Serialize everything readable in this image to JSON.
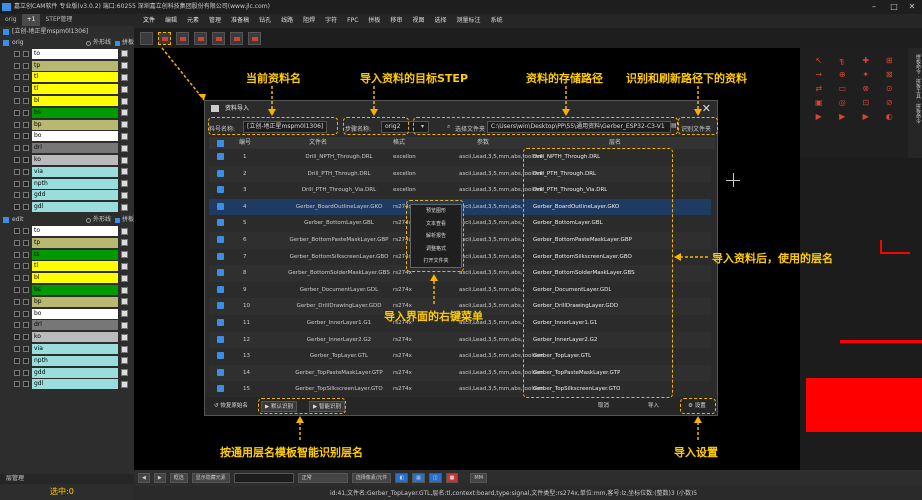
{
  "titlebar": {
    "text": "嘉立创CAM软件 专业版(v3.0.2) 端口:60255    深圳嘉立创科技集团股份有限公司(www.jlc.com)"
  },
  "left": {
    "tabs": [
      "orig",
      "+1",
      "STEP管理"
    ],
    "step_name": "[立创-地正星mspm0l1306]",
    "groups": [
      {
        "name": "orig",
        "outline": "外形线",
        "panel": "拼板",
        "layers": [
          {
            "name": "to",
            "color": "#ffffff"
          },
          {
            "name": "tp",
            "color": "#b8b870"
          },
          {
            "name": "tl",
            "color": "#ffff00"
          },
          {
            "name": "tl",
            "color": "#ffff00"
          },
          {
            "name": "bl",
            "color": "#ffff00"
          },
          {
            "name": "bs",
            "color": "#009900"
          },
          {
            "name": "bp",
            "color": "#b8b870"
          },
          {
            "name": "bo",
            "color": "#ffffff"
          },
          {
            "name": "drl",
            "color": "#777777"
          },
          {
            "name": "ko",
            "color": "#bbbbbb"
          },
          {
            "name": "via",
            "color": "#99dddd"
          },
          {
            "name": "npth",
            "color": "#99dddd"
          },
          {
            "name": "gdd",
            "color": "#99dddd"
          },
          {
            "name": "gdl",
            "color": "#99dddd"
          }
        ]
      },
      {
        "name": "edit",
        "outline": "外形线",
        "panel": "拼板",
        "layers": [
          {
            "name": "to",
            "color": "#ffffff"
          },
          {
            "name": "tp",
            "color": "#b8b870"
          },
          {
            "name": "ts",
            "color": "#009900"
          },
          {
            "name": "tl",
            "color": "#ffff00"
          },
          {
            "name": "bl",
            "color": "#ffff00"
          },
          {
            "name": "bs",
            "color": "#009900"
          },
          {
            "name": "bp",
            "color": "#b8b870"
          },
          {
            "name": "bo",
            "color": "#ffffff"
          },
          {
            "name": "drl",
            "color": "#777777"
          },
          {
            "name": "ko",
            "color": "#bbbbbb"
          },
          {
            "name": "via",
            "color": "#99dddd"
          },
          {
            "name": "npth",
            "color": "#99dddd"
          },
          {
            "name": "gdd",
            "color": "#99dddd"
          },
          {
            "name": "gdl",
            "color": "#99dddd"
          }
        ]
      }
    ],
    "bottom_tab": "层管理",
    "select_count": "选中:0"
  },
  "menubar": [
    "文件",
    "编辑",
    "元素",
    "管理",
    "准备稿",
    "钻孔",
    "线路",
    "阻焊",
    "字符",
    "FPC",
    "拼板",
    "移审",
    "视图",
    "选择",
    "测量标注",
    "系统"
  ],
  "annotations": {
    "current_name": "当前资料名",
    "target_step": "导入资料的目标STEP",
    "store_path": "资料的存储路径",
    "identify_refresh": "识别和刷新路径下的资料",
    "layer_name_after_import": "导入资料后，使用的层名",
    "right_click_menu": "导入界面的右键菜单",
    "auto_identify": "按通用层名模板智能识别层名",
    "import_settings": "导入设置"
  },
  "dialog": {
    "title": "资料导入",
    "name_label": "料号名称:",
    "name_value": "[立创-地正星mspm0l1306]",
    "step_label": "步骤名称:",
    "step_value": "orig2",
    "select_folder": "选择文件夹",
    "path_value": "C:\\Users\\win\\Desktop\\PP\\55\\通用资料\\Gerber_ESP32-C3-V1",
    "identify_folder": "识别文件夹",
    "columns": [
      "编号",
      "文件名",
      "格式",
      "参数",
      "层名"
    ],
    "rows": [
      {
        "no": "1",
        "file": "Drill_NPTH_Through.DRL",
        "fmt": "excellon",
        "param": "ascii,Lead,3,5,mm,abs,toolmm",
        "layer": "Drill_NPTH_Through.DRL"
      },
      {
        "no": "2",
        "file": "Drill_PTH_Through.DRL",
        "fmt": "excellon",
        "param": "ascii,Lead,3,5,mm,abs,toolmm",
        "layer": "Drill_PTH_Through.DRL"
      },
      {
        "no": "3",
        "file": "Drill_PTH_Through_Via.DRL",
        "fmt": "excellon",
        "param": "ascii,Lead,3,5,mm,abs,toolmm",
        "layer": "Drill_PTH_Through_Via.DRL"
      },
      {
        "no": "4",
        "file": "Gerber_BoardOutlineLayer.GKO",
        "fmt": "rs274x",
        "param": "ascii,Lead,3,5,mm,abs,",
        "layer": "Gerber_BoardOutlineLayer.GKO"
      },
      {
        "no": "5",
        "file": "Gerber_BottomLayer.GBL",
        "fmt": "rs274x",
        "param": "ascii,Lead,3,5,mm,abs,",
        "layer": "Gerber_BottomLayer.GBL"
      },
      {
        "no": "6",
        "file": "Gerber_BottomPasteMaskLayer.GBP",
        "fmt": "rs274x",
        "param": "ascii,Lead,3,5,mm,abs,",
        "layer": "Gerber_BottomPasteMaskLayer.GBP"
      },
      {
        "no": "7",
        "file": "Gerber_BottomSilkscreenLayer.GBO",
        "fmt": "rs274x",
        "param": "ascii,Lead,3,5,mm,abs,",
        "layer": "Gerber_BottomSilkscreenLayer.GBO"
      },
      {
        "no": "8",
        "file": "Gerber_BottomSolderMaskLayer.GBS",
        "fmt": "rs274x",
        "param": "ascii,Lead,3,5,mm,abs,",
        "layer": "Gerber_BottomSolderMaskLayer.GBS"
      },
      {
        "no": "9",
        "file": "Gerber_DocumentLayer.GDL",
        "fmt": "rs274x",
        "param": "ascii,Lead,3,5,mm,abs,",
        "layer": "Gerber_DocumentLayer.GDL"
      },
      {
        "no": "10",
        "file": "Gerber_DrillDrawingLayer.GDD",
        "fmt": "rs274x",
        "param": "ascii,Lead,3,5,mm,abs,",
        "layer": "Gerber_DrillDrawingLayer.GDD"
      },
      {
        "no": "11",
        "file": "Gerber_InnerLayer1.G1",
        "fmt": "rs274x",
        "param": "ascii,Lead,3,5,mm,abs,",
        "layer": "Gerber_InnerLayer1.G1"
      },
      {
        "no": "12",
        "file": "Gerber_InnerLayer2.G2",
        "fmt": "rs274x",
        "param": "ascii,Lead,3,5,mm,abs,",
        "layer": "Gerber_InnerLayer2.G2"
      },
      {
        "no": "13",
        "file": "Gerber_TopLayer.GTL",
        "fmt": "rs274x",
        "param": "ascii,Lead,3,5,mm,abs,toolmm",
        "layer": "Gerber_TopLayer.GTL"
      },
      {
        "no": "14",
        "file": "Gerber_TopPasteMaskLayer.GTP",
        "fmt": "rs274x",
        "param": "ascii,Lead,3,5,mm,abs,toolmm",
        "layer": "Gerber_TopPasteMaskLayer.GTP"
      },
      {
        "no": "15",
        "file": "Gerber_TopSilkscreenLayer.GTO",
        "fmt": "rs274x",
        "param": "ascii,Lead,3,5,mm,abs,toolmm",
        "layer": "Gerber_TopSilkscreenLayer.GTO"
      }
    ],
    "context_menu": [
      "预览图形",
      "文本查看",
      "解析报告",
      "调整格式",
      "打开文件夹"
    ],
    "restore_original": "恢复原始名",
    "default_identify": "默认识别",
    "auto_identify": "智能识别",
    "cancel": "取消",
    "import": "导入",
    "settings": "设置"
  },
  "statusbar": {
    "text": "id:41,文件名:Gerber_TopLayer.GTL,层名:tl,context:board,type:signal,文件类型:rs274x,单位:mm,客号:lz,坐标位数:(整数)3 (小数)5",
    "unit": "MM",
    "mode": "正常",
    "filter": "框选",
    "show_dup": "显示隐藏元素",
    "select_all": "选择像素/元件"
  },
  "colors": {
    "accent": "#3a8ee6",
    "annotation": "#ffcc00",
    "danger": "#ff0000"
  }
}
